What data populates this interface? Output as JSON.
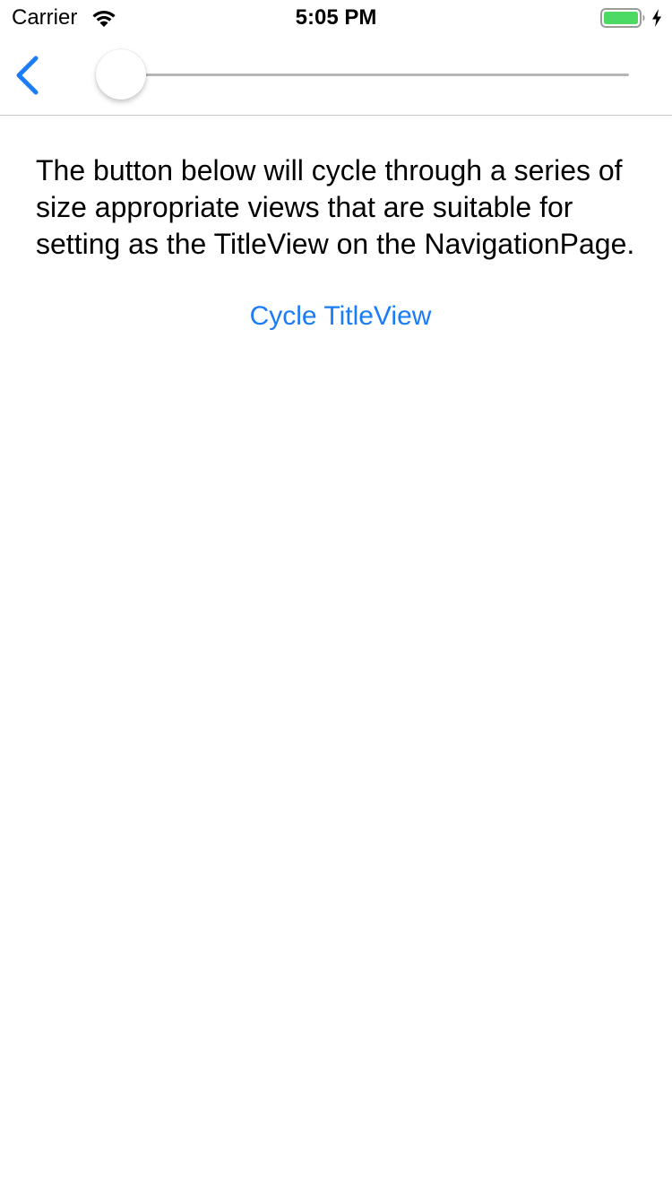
{
  "status_bar": {
    "carrier": "Carrier",
    "time": "5:05 PM",
    "battery_level": 1.0,
    "battery_color": "#4cd964",
    "wifi_icon": "wifi-icon",
    "charging_icon": "lightning-icon"
  },
  "nav_bar": {
    "back_icon": "chevron-left-icon",
    "slider_value": 0.0
  },
  "content": {
    "description": "The button below will cycle through a series of size appropriate views that are suitable for setting as the TitleView on the NavigationPage.",
    "cycle_button_label": "Cycle TitleView"
  },
  "colors": {
    "accent": "#1a7cf7",
    "separator": "#c8c7cc",
    "track": "#b6b6b6"
  }
}
